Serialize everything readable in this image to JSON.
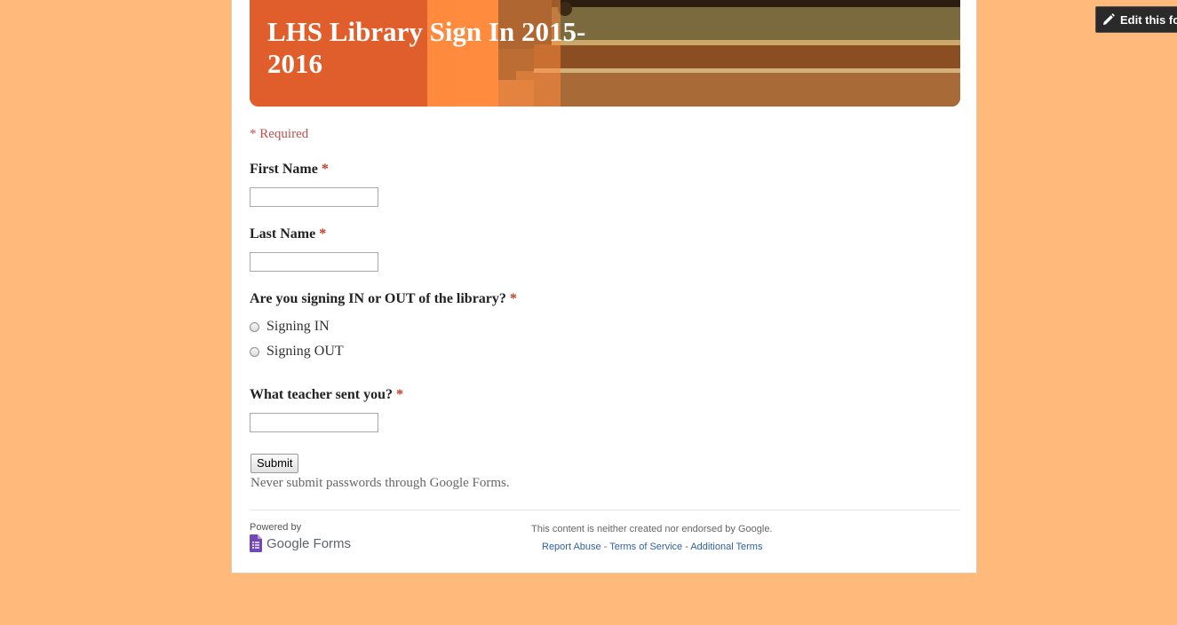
{
  "form": {
    "title": "LHS Library Sign In 2015-2016",
    "required_note": "* Required",
    "required_marker": "*",
    "questions": [
      {
        "label": "First Name",
        "type": "text",
        "value": ""
      },
      {
        "label": "Last Name",
        "type": "text",
        "value": ""
      },
      {
        "label": "Are you signing IN or OUT of the library?",
        "type": "radio",
        "options": [
          "Signing IN",
          "Signing OUT"
        ],
        "selected": null
      },
      {
        "label": "What teacher sent you?",
        "type": "text",
        "value": ""
      }
    ],
    "submit_label": "Submit",
    "warning": "Never submit passwords through Google Forms."
  },
  "footer": {
    "powered_by": "Powered by",
    "brand": "Google Forms",
    "disclaimer": "This content is neither created nor endorsed by Google.",
    "links": [
      "Report Abuse",
      "Terms of Service",
      "Additional Terms"
    ],
    "separator": " - "
  },
  "edit_button": {
    "label": "Edit this fo"
  },
  "colors": {
    "page_background": "#ffb97a",
    "header_accent": "#e05e2b",
    "required": "#c43b1d",
    "brand_purple": "#7248b9",
    "link": "#2f5fa5"
  },
  "icons": {
    "edit": "pencil-icon",
    "brand": "google-forms-icon"
  }
}
